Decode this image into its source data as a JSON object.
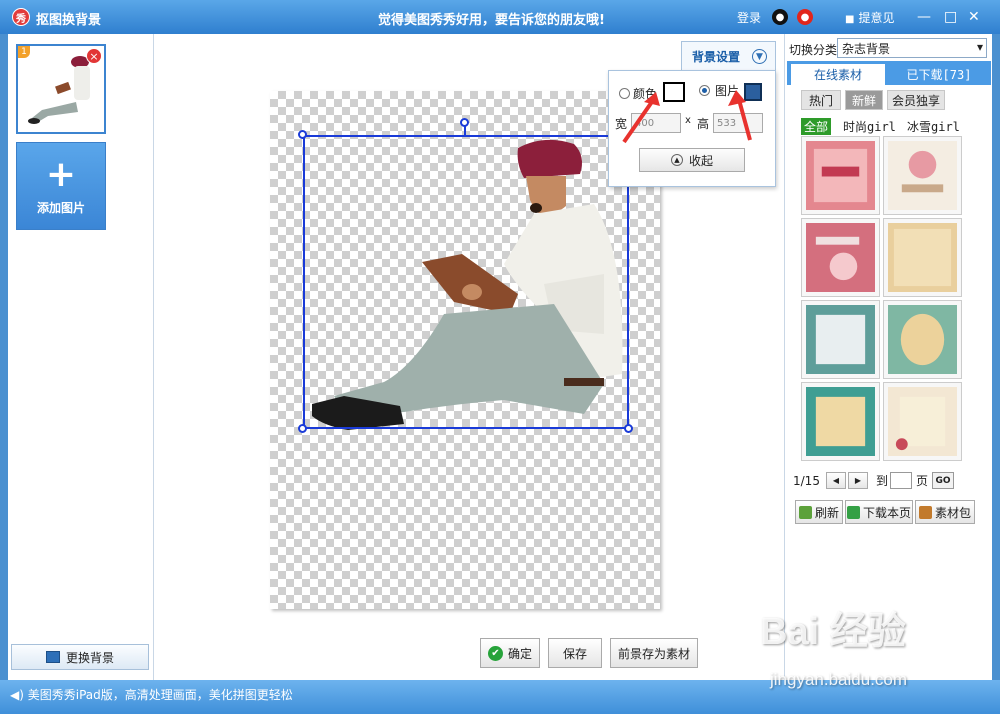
{
  "window": {
    "title": "抠图换背景",
    "logo_text": "秀",
    "promo": "觉得美图秀秀好用，要告诉您的朋友哦!",
    "login": "登录",
    "feedback": "提意见",
    "min": "—",
    "max": "□",
    "close": "✕"
  },
  "left": {
    "thumb_index": "1",
    "add_plus": "+",
    "add_label": "添加图片",
    "change_bg": "更换背景"
  },
  "bg_settings": {
    "tab_label": "背景设置",
    "color_label": "颜色",
    "image_label": "图片",
    "width_label": "宽",
    "width_value": "400",
    "times": "x",
    "height_label": "高",
    "height_value": "533",
    "collapse": "收起"
  },
  "actions": {
    "confirm": "确定",
    "save": "保存",
    "save_fg": "前景存为素材"
  },
  "right": {
    "switch_label": "切换分类",
    "category": "杂志背景",
    "tab_online": "在线素材",
    "tab_downloaded": "已下载[73]",
    "sub_tabs": [
      "热门",
      "新鲜",
      "会员独享"
    ],
    "filters": [
      "全部",
      "时尚girl",
      "冰雪girl"
    ],
    "page": "1/15",
    "to": "到",
    "page_unit": "页",
    "go": "GO",
    "refresh": "刷新",
    "download_page": "下载本页",
    "package": "素材包"
  },
  "status": {
    "text": "美图秀秀iPad版，高清处理画面，美化拼图更轻松"
  },
  "watermark": {
    "brand": "Bai 经验",
    "url": "jingyan.baidu.com"
  },
  "colors": {
    "accent": "#3a8ad8",
    "selection": "#1a3bd8",
    "arrow": "#e8322e"
  }
}
